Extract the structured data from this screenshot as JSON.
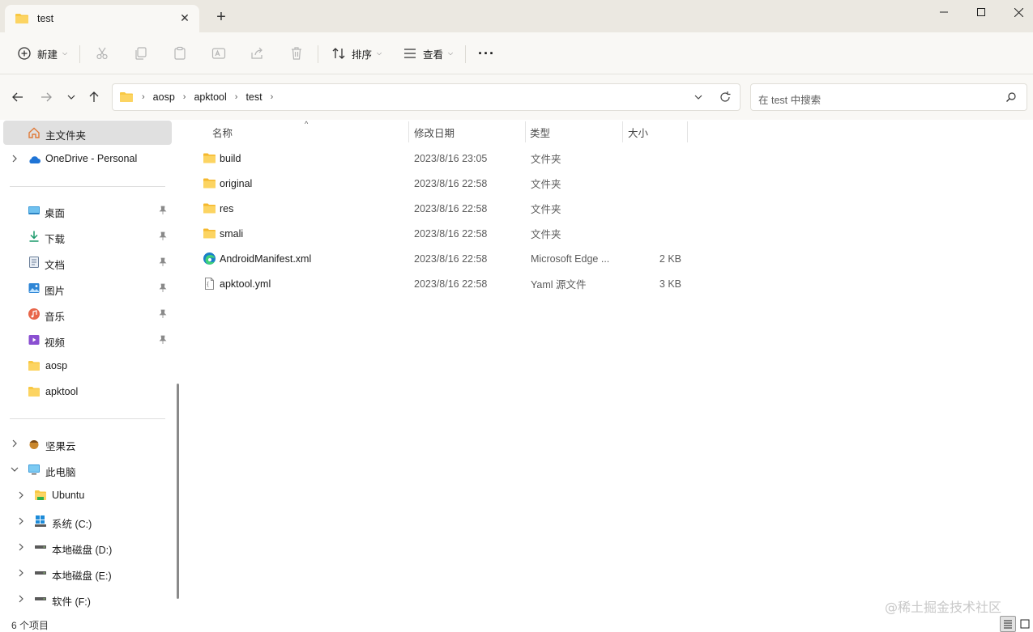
{
  "window": {
    "tab_title": "test",
    "new_tab_symbol": "+",
    "tab_close_symbol": "✕"
  },
  "toolbar": {
    "new_label": "新建",
    "sort_label": "排序",
    "view_label": "查看",
    "more_symbol": "···"
  },
  "address": {
    "crumbs": [
      "aosp",
      "apktool",
      "test"
    ],
    "search_placeholder": "在 test 中搜索"
  },
  "sidebar": {
    "home": "主文件夹",
    "onedrive": "OneDrive - Personal",
    "quick": [
      "桌面",
      "下载",
      "文档",
      "图片",
      "音乐",
      "视频",
      "aosp",
      "apktool"
    ],
    "jianguoyun": "坚果云",
    "this_pc": "此电脑",
    "drives": [
      "Ubuntu",
      "系统 (C:)",
      "本地磁盘 (D:)",
      "本地磁盘 (E:)",
      "软件 (F:)"
    ]
  },
  "columns": {
    "name": "名称",
    "modified": "修改日期",
    "type": "类型",
    "size": "大小"
  },
  "files": [
    {
      "name": "build",
      "modified": "2023/8/16 23:05",
      "type": "文件夹",
      "size": "",
      "icon": "folder-icon"
    },
    {
      "name": "original",
      "modified": "2023/8/16 22:58",
      "type": "文件夹",
      "size": "",
      "icon": "folder-icon"
    },
    {
      "name": "res",
      "modified": "2023/8/16 22:58",
      "type": "文件夹",
      "size": "",
      "icon": "folder-icon"
    },
    {
      "name": "smali",
      "modified": "2023/8/16 22:58",
      "type": "文件夹",
      "size": "",
      "icon": "folder-icon"
    },
    {
      "name": "AndroidManifest.xml",
      "modified": "2023/8/16 22:58",
      "type": "Microsoft Edge ...",
      "size": "2 KB",
      "icon": "edge-icon"
    },
    {
      "name": "apktool.yml",
      "modified": "2023/8/16 22:58",
      "type": "Yaml 源文件",
      "size": "3 KB",
      "icon": "file-icon"
    }
  ],
  "status": {
    "item_count": "6 个项目"
  },
  "watermark": "@稀土掘金技术社区",
  "colors": {
    "titlebar": "#ebe8e1",
    "chrome": "#f9f8f5",
    "selected": "#e0e0e0",
    "folder": "#f8c843"
  }
}
